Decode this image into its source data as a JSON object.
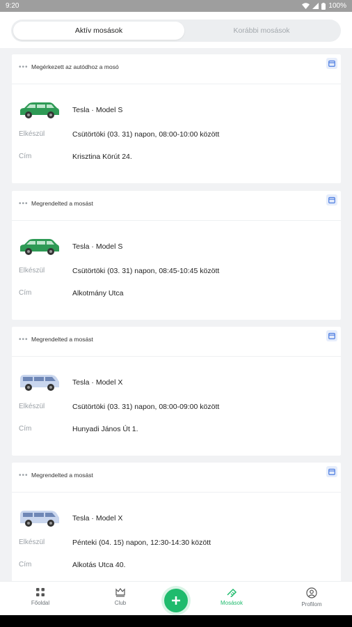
{
  "status_bar": {
    "time": "9:20",
    "battery": "100%"
  },
  "tabs": {
    "active": "Aktív mosások",
    "inactive": "Korábbi mosások"
  },
  "labels": {
    "prepare": "Elkészül",
    "address": "Cím"
  },
  "cards": [
    {
      "status": "Megérkezett az autódhoz a mosó",
      "car": "Tesla · Model S",
      "car_color": "green",
      "time": "Csütörtöki (03. 31) napon, 08:00-10:00 között",
      "address": "Krisztina Körút 24."
    },
    {
      "status": "Megrendelted a mosást",
      "car": "Tesla · Model S",
      "car_color": "green",
      "time": "Csütörtöki (03. 31) napon, 08:45-10:45 között",
      "address": "Alkotmány Utca"
    },
    {
      "status": "Megrendelted a mosást",
      "car": "Tesla · Model X",
      "car_color": "blue",
      "time": "Csütörtöki (03. 31) napon, 08:00-09:00 között",
      "address": "Hunyadi János Út 1."
    },
    {
      "status": "Megrendelted a mosást",
      "car": "Tesla · Model X",
      "car_color": "blue",
      "time": "Pénteki (04. 15) napon, 12:30-14:30 között",
      "address": "Alkotás Utca 40."
    }
  ],
  "bottom_nav": {
    "home": "Főoldal",
    "club": "Club",
    "washes": "Mosások",
    "profile": "Profilom"
  },
  "colors": {
    "accent": "#1fbb6d",
    "card_bg": "#ffffff",
    "page_bg": "#f1f2f4"
  }
}
